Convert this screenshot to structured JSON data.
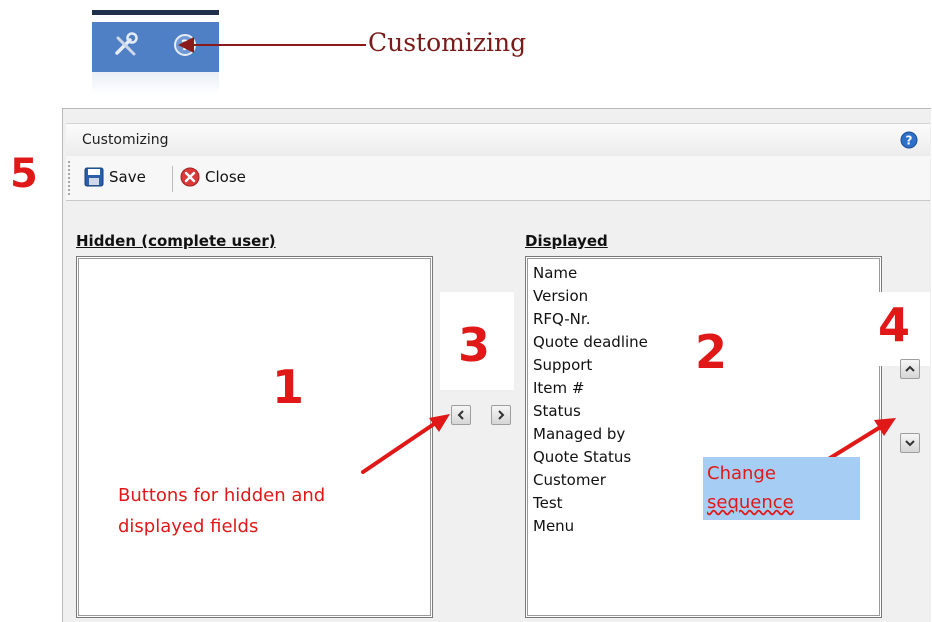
{
  "annotations": {
    "customizing_label": "Customizing",
    "step_1": "1",
    "step_2": "2",
    "step_3": "3",
    "step_4": "4",
    "step_5": "5",
    "buttons_note_line1": "Buttons for hidden and",
    "buttons_note_line2": "displayed fields",
    "change_line1": "Change",
    "change_line2": "sequence",
    "color": "#e01818"
  },
  "dialog": {
    "title": "Customizing",
    "toolbar": {
      "save_label": "Save",
      "close_label": "Close"
    },
    "hidden_header": "Hidden (complete user)",
    "displayed_header": "Displayed",
    "hidden_items": [],
    "displayed_items": [
      "Name",
      "Version",
      "RFQ-Nr.",
      "Quote deadline",
      "Support",
      "Item #",
      "Status",
      "Managed by",
      "Quote Status",
      "Customer",
      "Test",
      "Menu"
    ]
  },
  "icons": [
    "tools-icon",
    "help-icon",
    "save-icon",
    "close-icon",
    "chevron-left-icon",
    "chevron-right-icon",
    "chevron-up-icon",
    "chevron-down-icon"
  ],
  "colors": {
    "accent": "#4f7fc5",
    "annotation_red": "#e01818",
    "highlight": "#a6cdf4"
  }
}
